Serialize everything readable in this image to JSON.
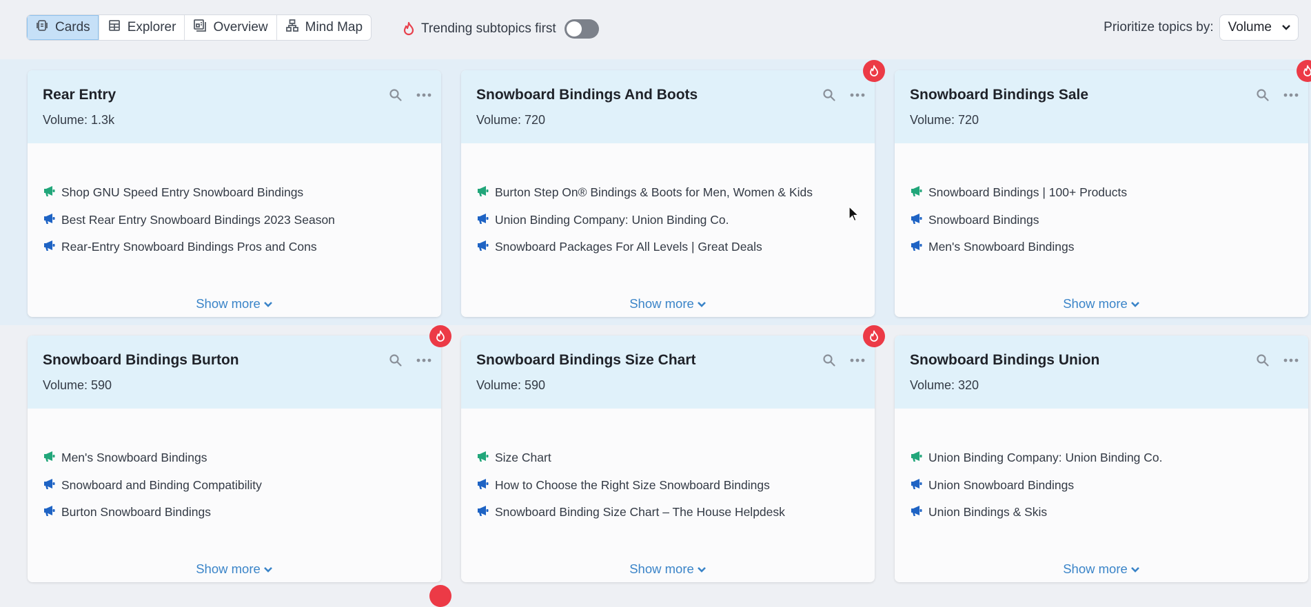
{
  "toolbar": {
    "view_tabs": [
      {
        "label": "Cards",
        "icon": "cards-icon",
        "active": true
      },
      {
        "label": "Explorer",
        "icon": "table-icon",
        "active": false
      },
      {
        "label": "Overview",
        "icon": "overview-icon",
        "active": false
      },
      {
        "label": "Mind Map",
        "icon": "mind-map-icon",
        "active": false
      }
    ],
    "trending_label": "Trending subtopics first",
    "trending_enabled": false,
    "prioritize_label": "Prioritize topics by:",
    "prioritize_value": "Volume"
  },
  "colors": {
    "accent_blue": "#3a84c8",
    "trend_red": "#ec3a46",
    "ad_green": "#21a67a",
    "ad_blue": "#1e63c4",
    "card_header_bg": "#e0f1fa"
  },
  "cards": [
    {
      "title": "Rear Entry",
      "volume_label": "Volume:",
      "volume": "1.3k",
      "trending": false,
      "items": [
        {
          "type": "green",
          "text": "Shop GNU Speed Entry Snowboard Bindings"
        },
        {
          "type": "blue",
          "text": "Best Rear Entry Snowboard Bindings 2023 Season"
        },
        {
          "type": "blue",
          "text": "Rear-Entry Snowboard Bindings Pros and Cons"
        }
      ],
      "show_more": "Show more"
    },
    {
      "title": "Snowboard Bindings And Boots",
      "volume_label": "Volume:",
      "volume": "720",
      "trending": true,
      "items": [
        {
          "type": "green",
          "text": "Burton Step On® Bindings & Boots for Men, Women & Kids"
        },
        {
          "type": "blue",
          "text": "Union Binding Company: Union Binding Co."
        },
        {
          "type": "blue",
          "text": "Snowboard Packages For All Levels | Great Deals"
        }
      ],
      "show_more": "Show more"
    },
    {
      "title": "Snowboard Bindings Sale",
      "volume_label": "Volume:",
      "volume": "720",
      "trending": true,
      "items": [
        {
          "type": "green",
          "text": "Snowboard Bindings | 100+ Products"
        },
        {
          "type": "blue",
          "text": "Snowboard Bindings"
        },
        {
          "type": "blue",
          "text": "Men's Snowboard Bindings"
        }
      ],
      "show_more": "Show more"
    },
    {
      "title": "Snowboard Bindings Burton",
      "volume_label": "Volume:",
      "volume": "590",
      "trending": true,
      "items": [
        {
          "type": "green",
          "text": "Men's Snowboard Bindings"
        },
        {
          "type": "blue",
          "text": "Snowboard and Binding Compatibility"
        },
        {
          "type": "blue",
          "text": "Burton Snowboard Bindings"
        }
      ],
      "show_more": "Show more"
    },
    {
      "title": "Snowboard Bindings Size Chart",
      "volume_label": "Volume:",
      "volume": "590",
      "trending": true,
      "items": [
        {
          "type": "green",
          "text": "Size Chart"
        },
        {
          "type": "blue",
          "text": "How to Choose the Right Size Snowboard Bindings"
        },
        {
          "type": "blue",
          "text": "Snowboard Binding Size Chart – The House Helpdesk"
        }
      ],
      "show_more": "Show more"
    },
    {
      "title": "Snowboard Bindings Union",
      "volume_label": "Volume:",
      "volume": "320",
      "trending": false,
      "items": [
        {
          "type": "green",
          "text": "Union Binding Company: Union Binding Co."
        },
        {
          "type": "blue",
          "text": "Union Snowboard Bindings"
        },
        {
          "type": "blue",
          "text": "Union Bindings & Skis"
        }
      ],
      "show_more": "Show more"
    }
  ]
}
